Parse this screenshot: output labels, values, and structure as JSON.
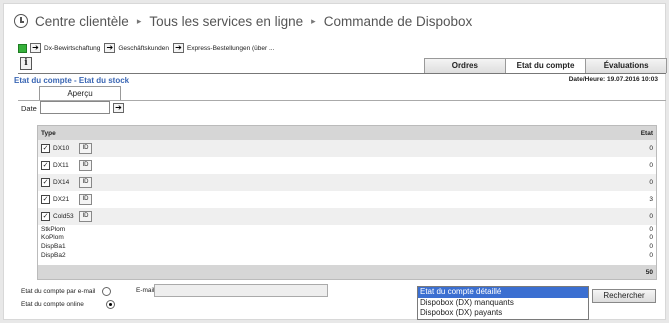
{
  "breadcrumb": {
    "items": [
      "Centre clientèle",
      "Tous les services en ligne",
      "Commande de Dispobox"
    ],
    "separator": "▸"
  },
  "nav": {
    "items": [
      "Dx-Bewirtschaftung",
      "Geschäftskunden",
      "Express-Bestellungen (über ..."
    ]
  },
  "tabs": [
    {
      "label": "Ordres",
      "active": false
    },
    {
      "label": "Etat du compte",
      "active": true
    },
    {
      "label": "Évaluations",
      "active": false
    }
  ],
  "section": {
    "title": "Etat du compte - Etat du stock",
    "datetime": "Date/Heure: 19.07.2016 10:03"
  },
  "subtab": {
    "label": "Aperçu"
  },
  "date": {
    "label": "Date",
    "value": ""
  },
  "grid": {
    "header": {
      "type": "Type",
      "etat": "Etat"
    },
    "rows": [
      {
        "name": "DX10",
        "etat": "0",
        "checked": true,
        "id_label": "ID"
      },
      {
        "name": "DX11",
        "etat": "0",
        "checked": true,
        "id_label": "ID"
      },
      {
        "name": "DX14",
        "etat": "0",
        "checked": true,
        "id_label": "ID"
      },
      {
        "name": "DX21",
        "etat": "3",
        "checked": true,
        "id_label": "ID"
      },
      {
        "name": "Cold53",
        "etat": "0",
        "checked": true,
        "id_label": "ID"
      }
    ],
    "sub_rows": [
      {
        "name": "StkPlom",
        "etat": "0"
      },
      {
        "name": "KoPlom",
        "etat": "0"
      },
      {
        "name": "DispBa1",
        "etat": "0"
      },
      {
        "name": "DispBa2",
        "etat": "0"
      }
    ],
    "total": "50"
  },
  "options": {
    "email_label": "Etat du compte par e-mail",
    "email_field_label": "E-mail",
    "email_value": "",
    "online_label": "Etat du compte online",
    "selected": "online"
  },
  "report_list": {
    "options": [
      "Etat du compte détaillé",
      "Dispobox (DX) manquants",
      "Dispobox (DX) payants"
    ],
    "selected_index": 0
  },
  "search_button": "Rechercher",
  "colors": {
    "accent": "#3a66b4",
    "selection": "#3b6fd1",
    "active_indicator": "#35b03a"
  }
}
